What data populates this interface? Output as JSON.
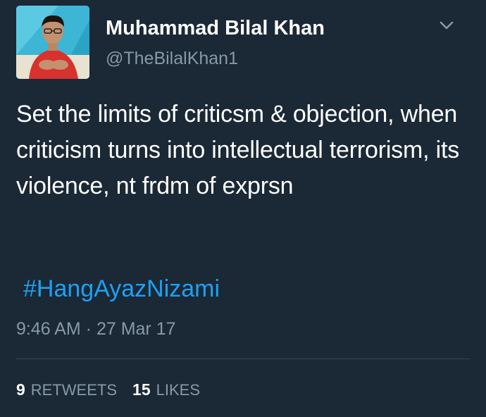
{
  "author": {
    "display_name": "Muhammad Bilal Khan",
    "handle": "@TheBilalKhan1"
  },
  "tweet": {
    "text": "Set the limits of criticsm & objection, when criticism turns into intellectual terrorism, its violence, nt frdm of exprsn",
    "hashtag": "#HangAyazNizami",
    "timestamp": "9:46 AM · 27 Mar 17"
  },
  "stats": {
    "retweets_count": "9",
    "retweets_label": "RETWEETS",
    "likes_count": "15",
    "likes_label": "LIKES"
  },
  "icons": {
    "menu": "chevron-down-icon"
  },
  "colors": {
    "background": "#1b2836",
    "text": "#ffffff",
    "secondary": "#8899a6",
    "link": "#1da1f2",
    "divider": "#38444d"
  }
}
